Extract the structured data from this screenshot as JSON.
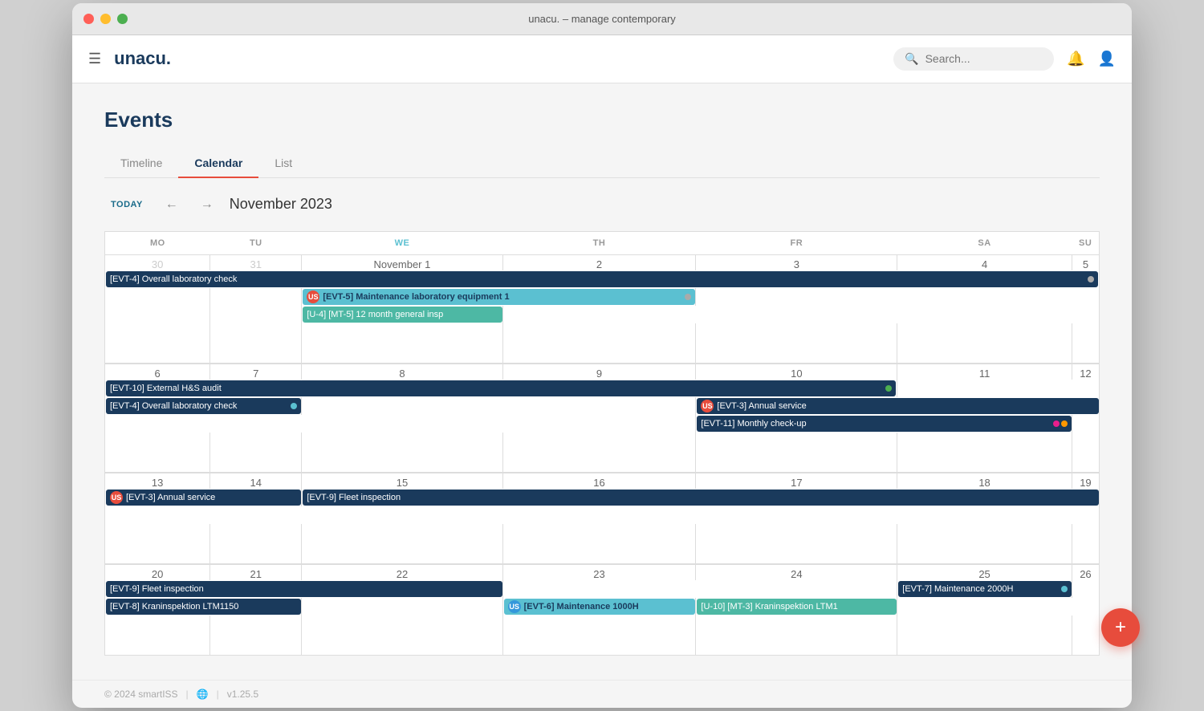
{
  "window": {
    "title": "unacu. – manage contemporary"
  },
  "topbar": {
    "logo": "unacu.",
    "search_placeholder": "Search...",
    "hamburger_label": "☰"
  },
  "page": {
    "title": "Events",
    "tabs": [
      "Timeline",
      "Calendar",
      "List"
    ],
    "active_tab": "Calendar"
  },
  "calendar": {
    "today_label": "TODAY",
    "month_title": "November 2023",
    "weekdays": [
      "MO",
      "TU",
      "WE",
      "TH",
      "FR",
      "SA",
      "SU"
    ],
    "today_weekday": "WE"
  },
  "footer": {
    "copyright": "© 2024 smartISS",
    "version": "v1.25.5"
  },
  "fab": {
    "label": "+"
  }
}
